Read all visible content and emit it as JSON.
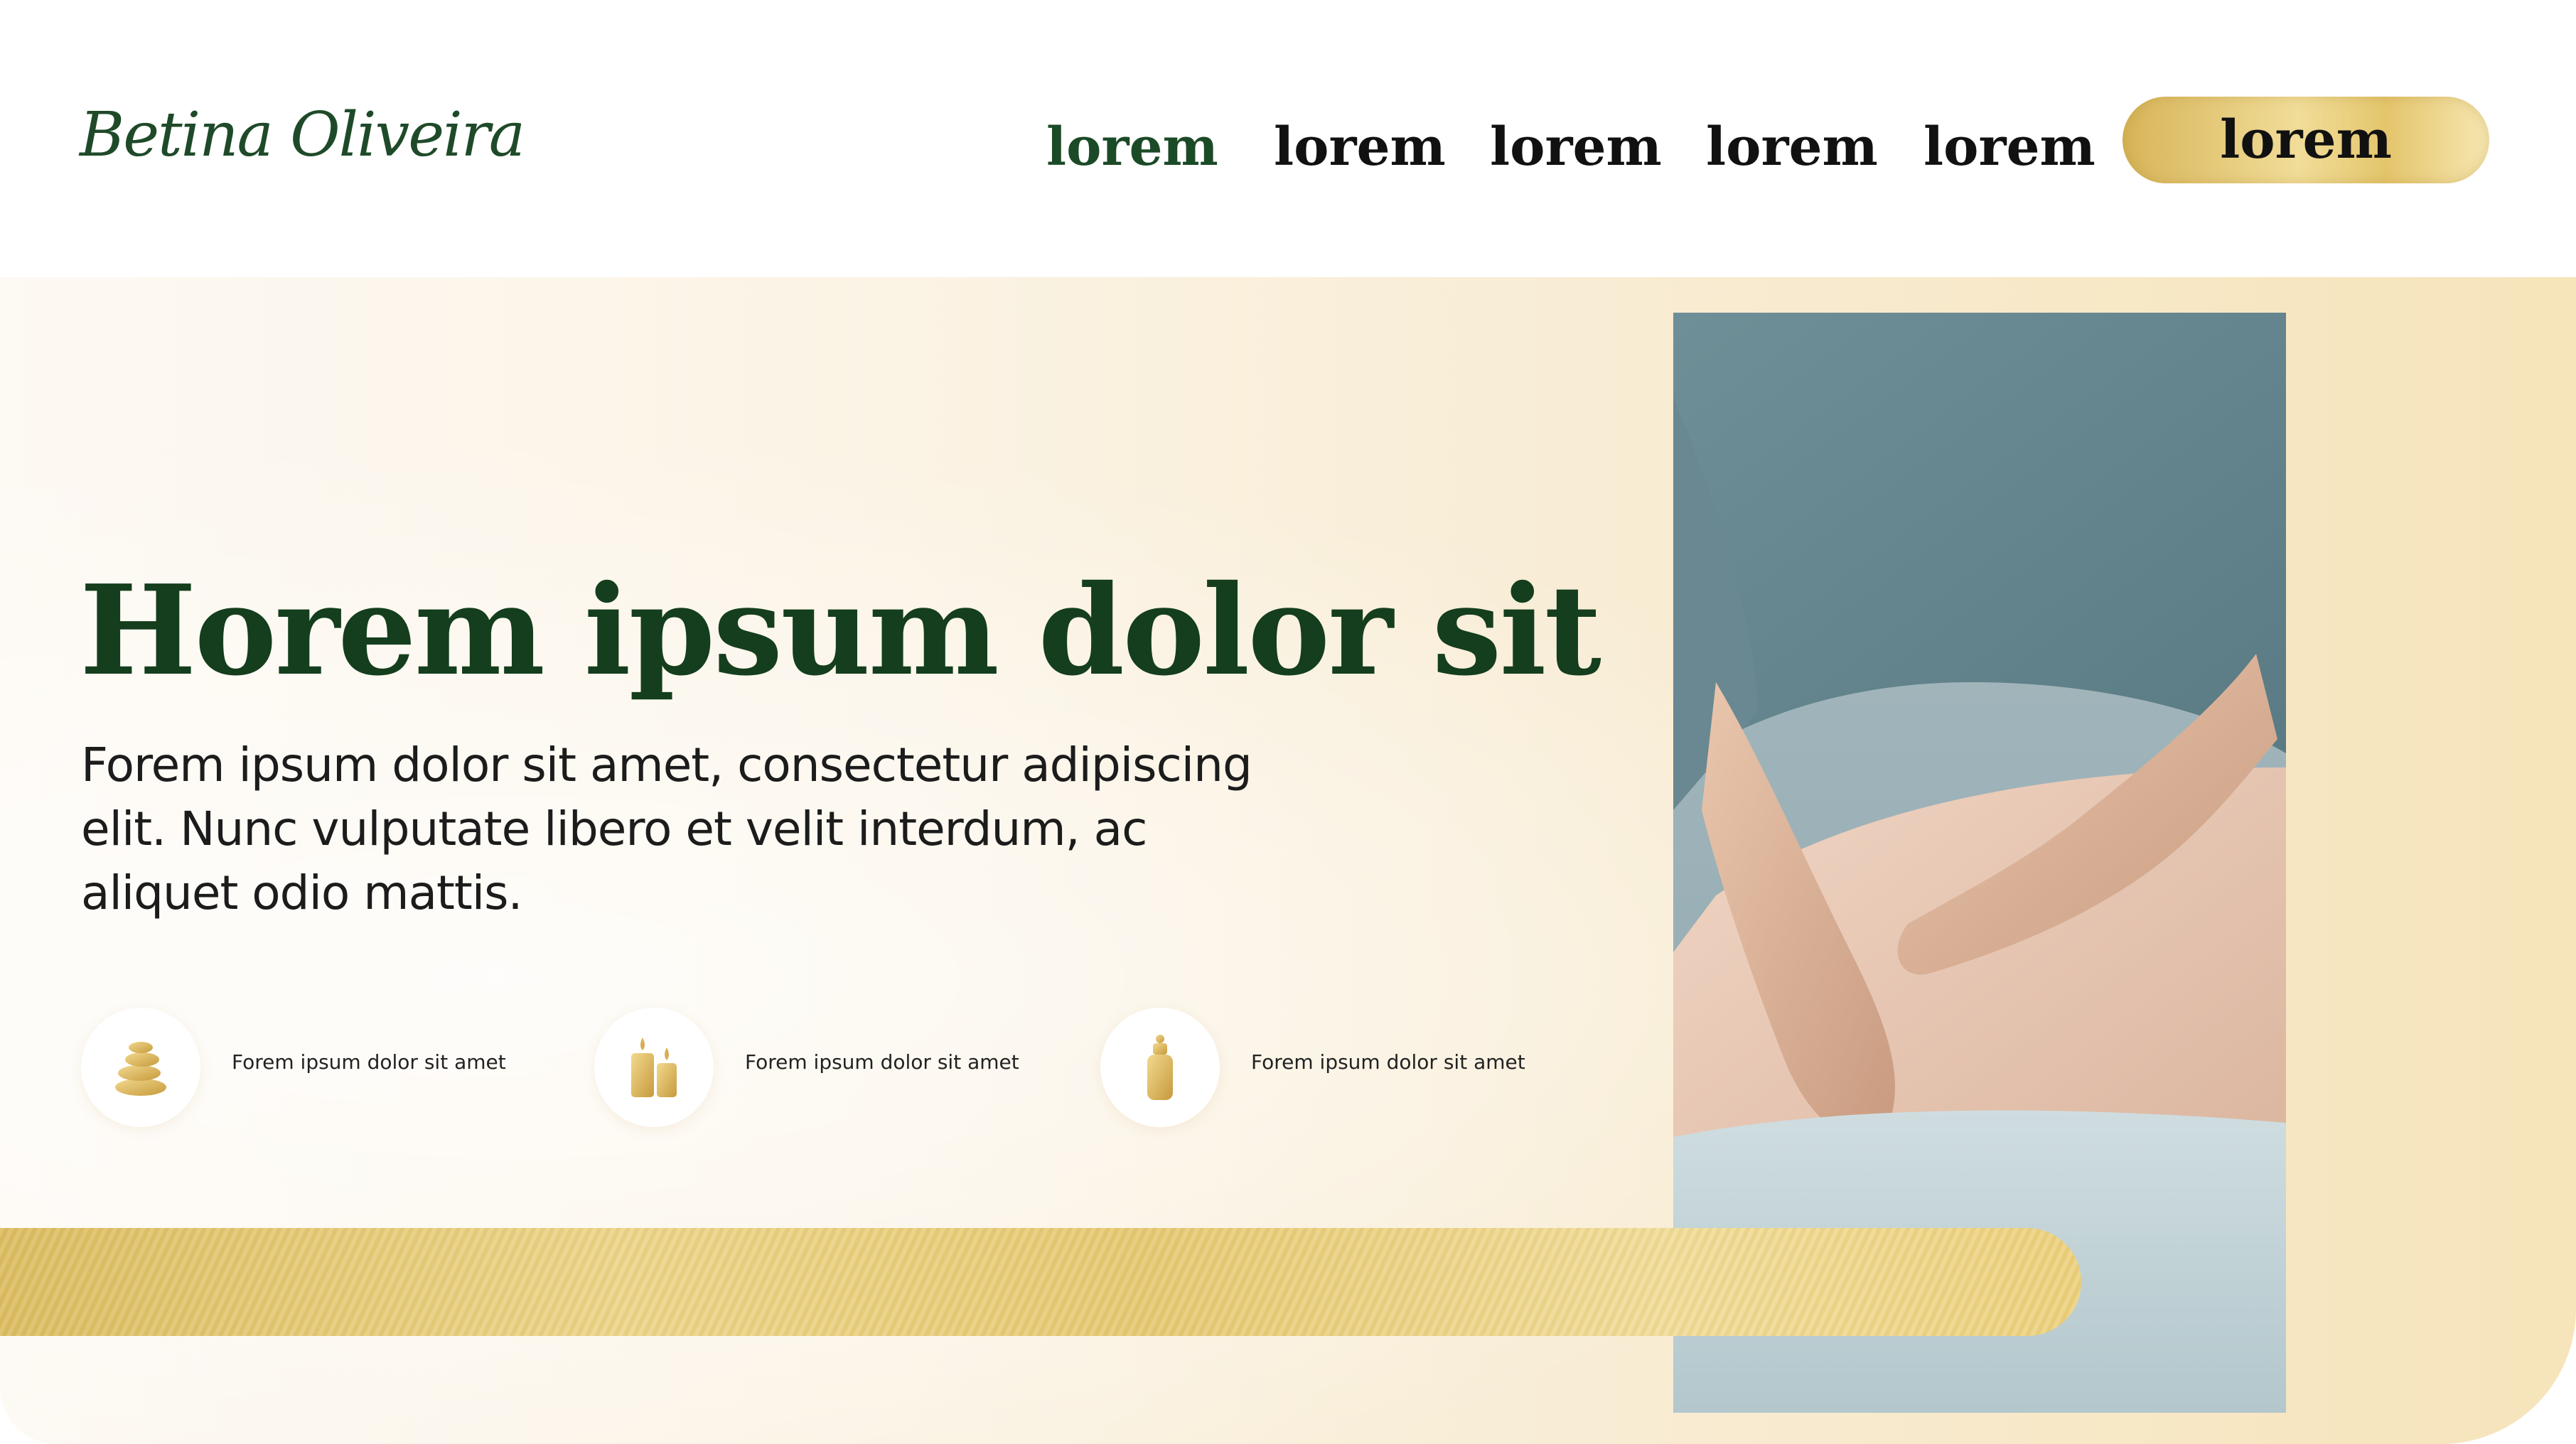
{
  "header": {
    "logo": "Betina Oliveira",
    "nav": [
      "lorem",
      "lorem",
      "lorem",
      "lorem",
      "lorem"
    ],
    "cta": "lorem"
  },
  "hero": {
    "headline": "Horem ipsum dolor sit",
    "subtext": "Forem ipsum dolor sit amet, consectetur adipiscing elit. Nunc vulputate libero et velit interdum, ac aliquet odio mattis.",
    "features": [
      {
        "icon": "stacked-stones-icon",
        "text": "Forem ipsum dolor sit amet"
      },
      {
        "icon": "candles-icon",
        "text": "Forem ipsum dolor sit amet"
      },
      {
        "icon": "oil-bottle-icon",
        "text": "Forem ipsum dolor sit amet"
      }
    ],
    "photo": "massage-therapist-photo"
  },
  "colors": {
    "brand_green": "#143e1d",
    "gold": "#e6c973",
    "background_cream": "#fbf3e4"
  }
}
